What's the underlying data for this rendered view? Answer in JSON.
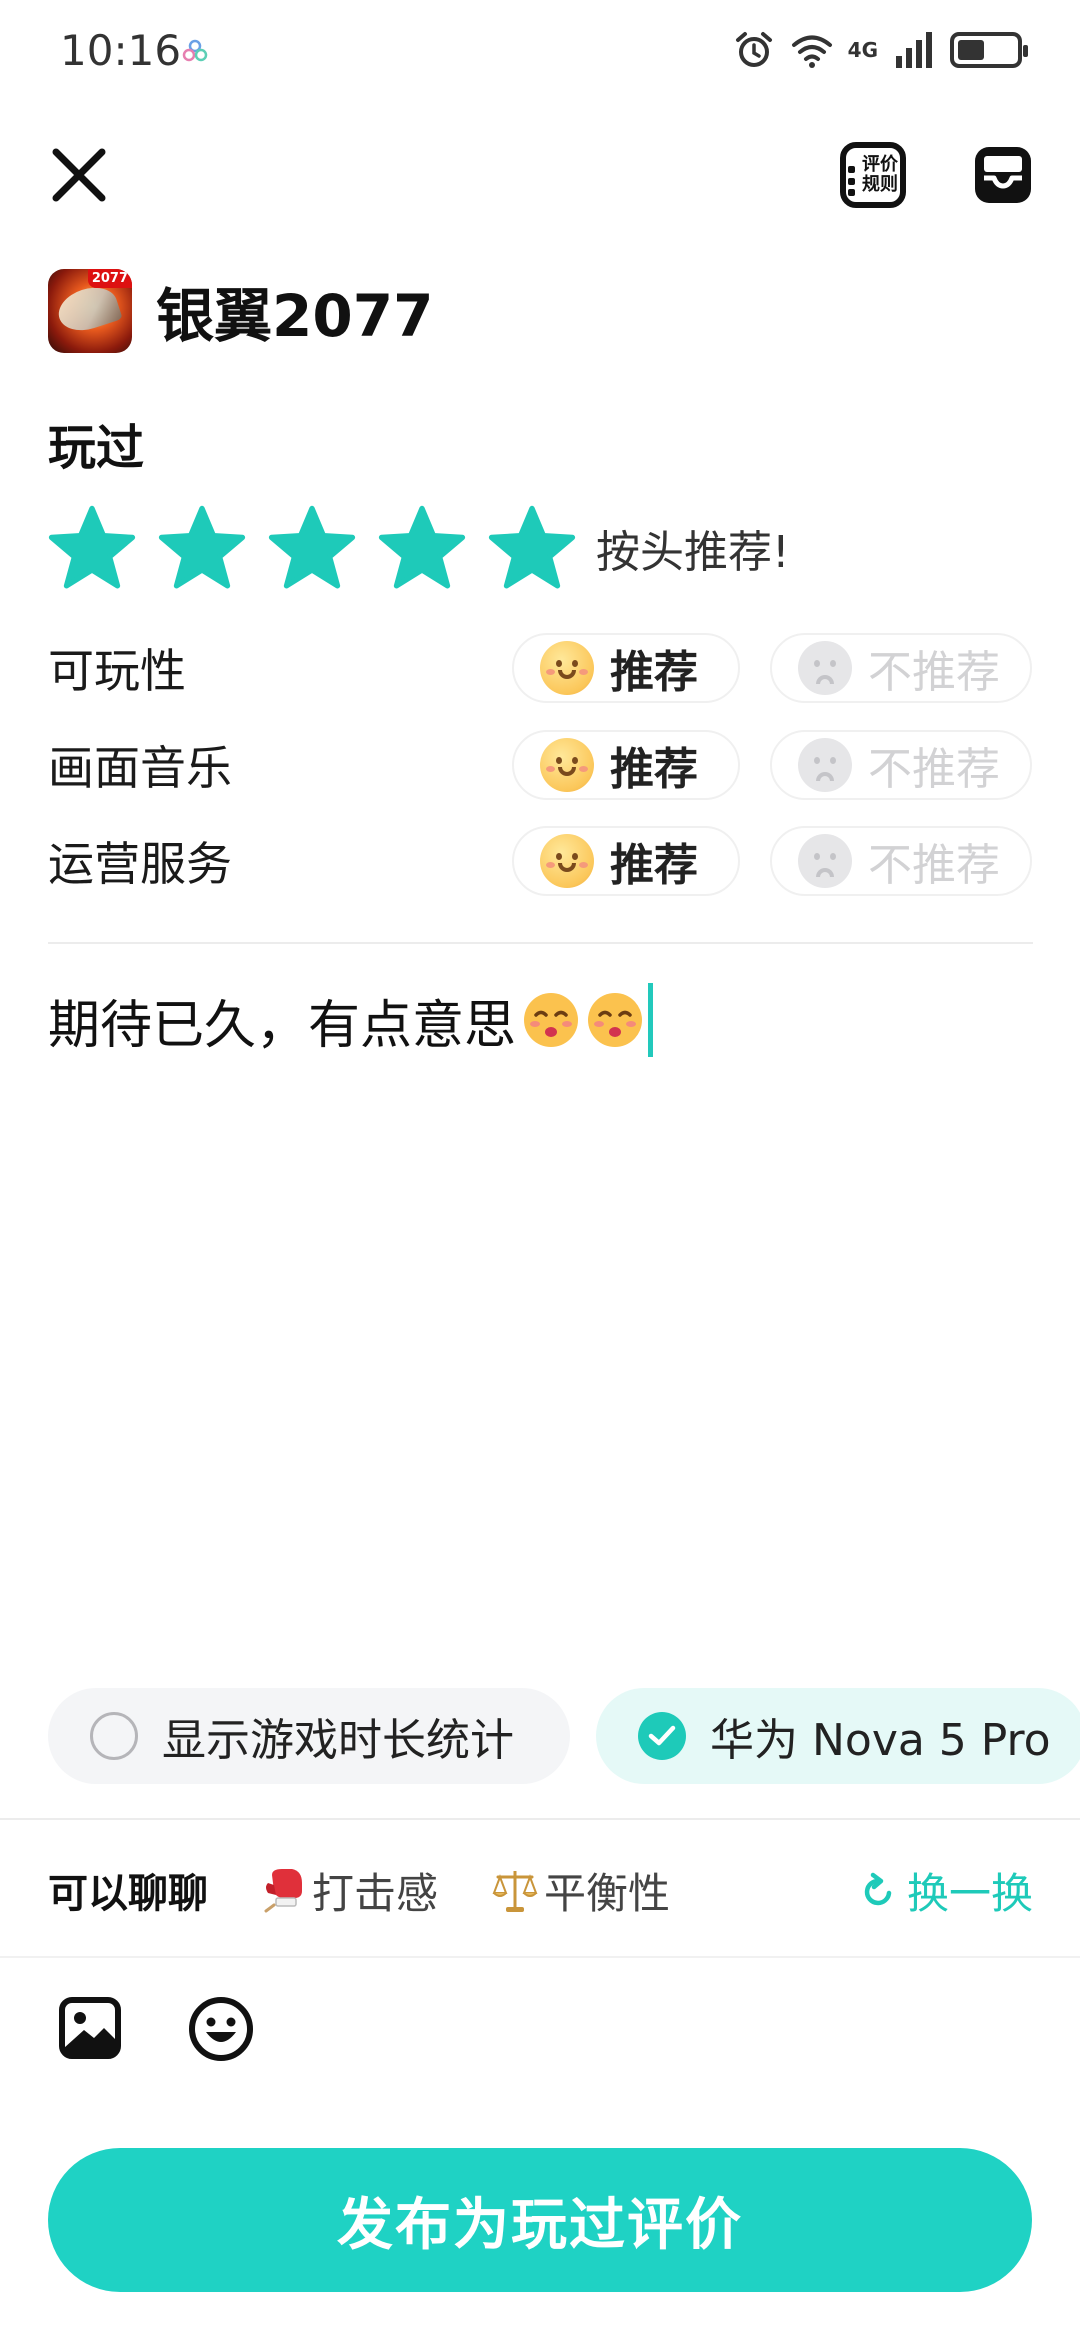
{
  "status_bar": {
    "time": "10:16",
    "network": "4G"
  },
  "header": {
    "rules_label_line1": "评价",
    "rules_label_line2": "规则"
  },
  "game": {
    "title": "银翼2077",
    "badge": "2077"
  },
  "section": {
    "played_label": "玩过"
  },
  "rating": {
    "stars": 5,
    "max_stars": 5,
    "text": "按头推荐!"
  },
  "aspects": [
    {
      "label": "可玩性",
      "recommend": "推荐",
      "not_recommend": "不推荐",
      "selected": "recommend"
    },
    {
      "label": "画面音乐",
      "recommend": "推荐",
      "not_recommend": "不推荐",
      "selected": "recommend"
    },
    {
      "label": "运营服务",
      "recommend": "推荐",
      "not_recommend": "不推荐",
      "selected": "recommend"
    }
  ],
  "review": {
    "text": "期待已久，有点意思"
  },
  "options": {
    "show_playtime": {
      "label": "显示游戏时长统计",
      "checked": false
    },
    "device": {
      "label": "华为 Nova 5 Pro",
      "checked": true
    }
  },
  "topics": {
    "title": "可以聊聊",
    "items": [
      {
        "label": "打击感"
      },
      {
        "label": "平衡性"
      }
    ],
    "refresh": "换一换"
  },
  "publish": {
    "label": "发布为玩过评价"
  },
  "colors": {
    "accent": "#1fd2c4",
    "star": "#1ecab9"
  }
}
